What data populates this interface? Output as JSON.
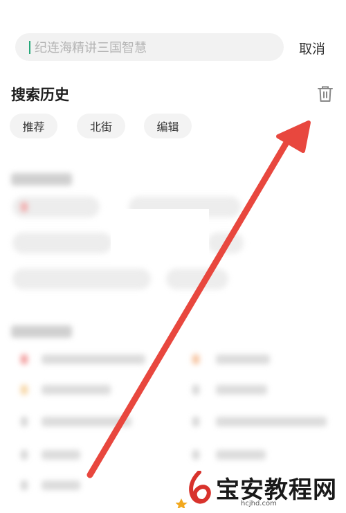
{
  "search": {
    "placeholder": "纪连海精讲三国智慧",
    "cancel_label": "取消"
  },
  "history": {
    "title": "搜索历史",
    "items": [
      "推荐",
      "北街",
      "编辑"
    ]
  },
  "icons": {
    "delete": "trash-icon",
    "annotation": "red-arrow"
  },
  "colors": {
    "arrow": "#e8473e",
    "caret": "#27a87a"
  },
  "watermark": {
    "text": "宝安教程网",
    "url": "hcjhd.com"
  }
}
